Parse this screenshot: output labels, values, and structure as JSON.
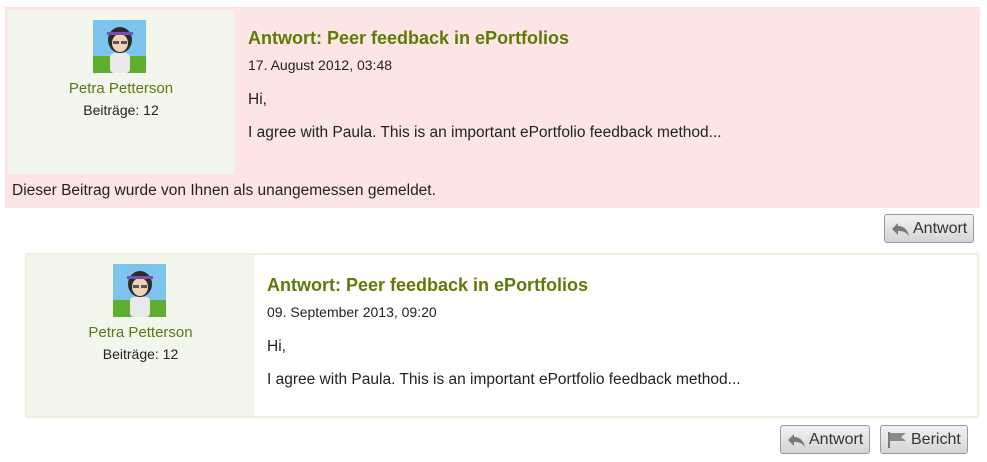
{
  "posts": [
    {
      "author": "Petra Petterson",
      "posts_count": "Beiträge: 12",
      "subject": "Antwort: Peer feedback in ePortfolios",
      "date": "17. August 2012, 03:48",
      "greeting": "Hi,",
      "body": "I agree with Paula. This is an important ePortfolio feedback method...",
      "flag_note": "Dieser Beitrag wurde von Ihnen als unangemessen gemeldet.",
      "reply_label": "Antwort",
      "highlight_color": "#fde5e5"
    },
    {
      "author": "Petra Petterson",
      "posts_count": "Beiträge: 12",
      "subject": "Antwort: Peer feedback in ePortfolios",
      "date": "09. September 2013, 09:20",
      "greeting": "Hi,",
      "body": "I agree with Paula. This is an important ePortfolio feedback method...",
      "reply_label": "Antwort",
      "report_label": "Bericht"
    }
  ],
  "colors": {
    "accent": "#5e7a07",
    "author_panel": "#f3f6ec"
  },
  "icons": {
    "avatar": "avatar-image",
    "reply": "reply-arrow-icon",
    "report": "flag-icon"
  }
}
